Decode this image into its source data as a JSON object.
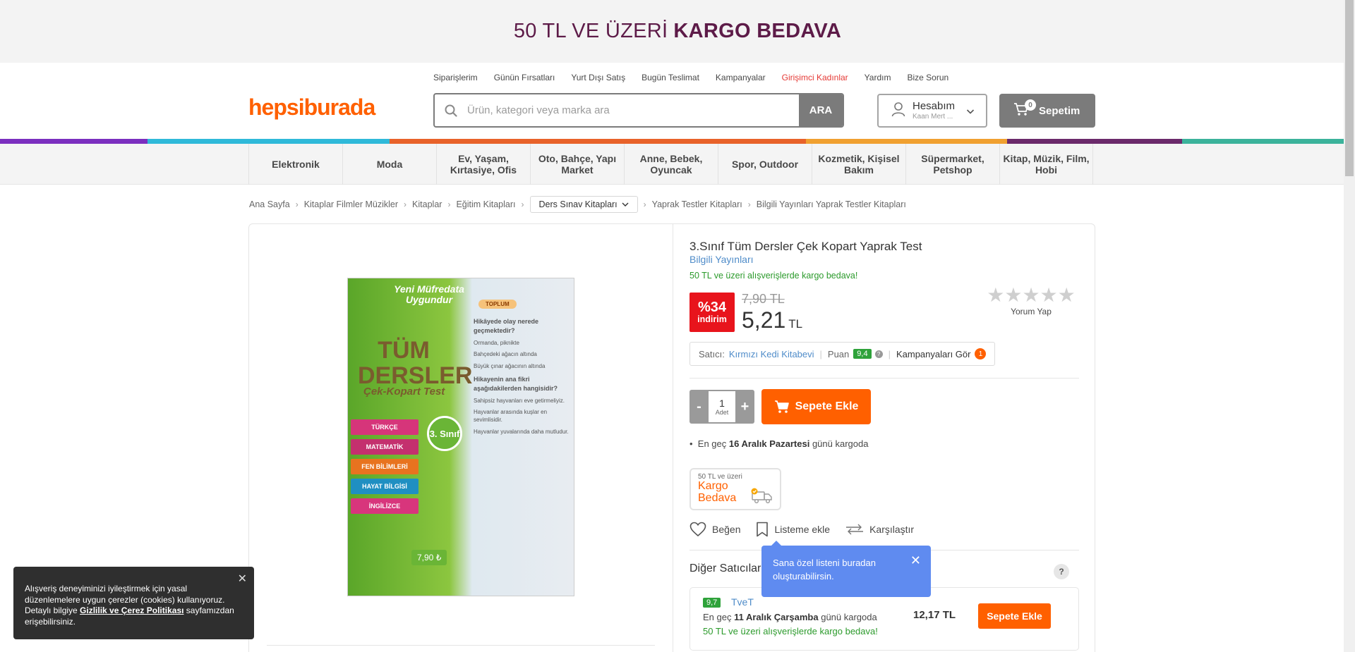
{
  "promo": {
    "prefix": "50 TL VE ÜZERİ",
    "strong": "KARGO BEDAVA"
  },
  "top_links": [
    "Siparişlerim",
    "Günün Fırsatları",
    "Yurt Dışı Satış",
    "Bugün Teslimat",
    "Kampanyalar",
    "Girişimci Kadınlar",
    "Yardım",
    "Bize Sorun"
  ],
  "logo": "hepsiburada",
  "search": {
    "placeholder": "Ürün, kategori veya marka ara",
    "button": "ARA"
  },
  "account": {
    "label": "Hesabım",
    "user": "Kaan Mert ..."
  },
  "cart": {
    "label": "Sepetim",
    "count": "0"
  },
  "stripe_colors": [
    "#7b2fbf",
    "#2fb9d9",
    "#e8622a",
    "#f0a030",
    "#6b2a6b",
    "#3bb39b"
  ],
  "categories": [
    {
      "label": "Elektronik"
    },
    {
      "label": "Moda"
    },
    {
      "label": "Ev, Yaşam, Kırtasiye, Ofis"
    },
    {
      "label": "Oto, Bahçe, Yapı Market"
    },
    {
      "label": "Anne, Bebek, Oyuncak"
    },
    {
      "label": "Spor, Outdoor"
    },
    {
      "label": "Kozmetik, Kişisel Bakım"
    },
    {
      "label": "Süpermarket, Petshop"
    },
    {
      "label": "Kitap, Müzik, Film, Hobi"
    }
  ],
  "breadcrumb": {
    "items": [
      "Ana Sayfa",
      "Kitaplar Filmler Müzikler",
      "Kitaplar",
      "Eğitim Kitapları"
    ],
    "dropdown": "Ders Sınav Kitapları",
    "tail": [
      "Yaprak Testler Kitapları",
      "Bilgili Yayınları Yaprak Testler Kitapları"
    ]
  },
  "book_cover": {
    "header": "Yeni Müfredata Uygundur",
    "title": "TÜM DERSLER",
    "subtitle": "Çek-Kopart Test",
    "tabs": [
      "TÜRKÇE",
      "MATEMATİK",
      "FEN BİLİMLERİ",
      "HAYAT BİLGİSİ",
      "İNGİLİZCE"
    ],
    "grade": "3. Sınıf",
    "price": "7,90 ₺",
    "badge": "TOPLUM",
    "lines": [
      "Hikâyede olay nerede geçmektedir?",
      "Ormanda, piknikte",
      "Bahçedeki ağacın altında",
      "Büyük çınar ağacının altında",
      "Hikayenin ana fikri aşağıdakilerden hangisidir?",
      "Sahipsiz hayvanları eve getirmeliyiz.",
      "Hayvanlar arasında kuşlar en sevimlisidir.",
      "Hayvanlar yuvalarında daha mutludur."
    ]
  },
  "product": {
    "title": "3.Sınıf Tüm Dersler Çek Kopart Yaprak Test",
    "brand": "Bilgili Yayınları",
    "shipping_note": "50 TL ve üzeri alışverişlerde kargo bedava!",
    "discount_pct": "%34",
    "discount_label": "indirim",
    "old_price": "7,90 TL",
    "price": "5,21",
    "currency": "TL",
    "rating_stars": 0,
    "review_label": "Yorum Yap",
    "seller_label": "Satıcı:",
    "seller_name": "Kırmızı Kedi Kitabevi",
    "score_label": "Puan",
    "score": "9,4",
    "campaigns_label": "Kampanyaları Gör",
    "campaigns_count": "1",
    "quantity": "1",
    "quantity_unit": "Adet",
    "add_to_cart": "Sepete Ekle",
    "delivery_prefix": "En geç",
    "delivery_date": "16 Aralık Pazartesi",
    "delivery_suffix": "günü kargoda",
    "kargo_small": "50 TL ve üzeri",
    "kargo_big1": "Kargo",
    "kargo_big2": "Bedava",
    "like": "Beğen",
    "list_add": "Listeme ekle",
    "compare": "Karşılaştır"
  },
  "other_sellers": {
    "title": "Diğer Satıcılar",
    "offers": [
      {
        "score": "9,7",
        "name": "TveT",
        "delivery_prefix": "En geç",
        "delivery_date": "11 Aralık Çarşamba",
        "delivery_suffix": "günü kargoda",
        "free_ship": "50 TL ve üzeri alışverişlerde kargo bedava!",
        "price": "12,17 TL",
        "button": "Sepete Ekle"
      }
    ]
  },
  "tooltip": {
    "text": "Sana özel listeni buradan oluşturabilirsin."
  },
  "cookie": {
    "text1": "Alışveriş deneyiminizi iyileştirmek için yasal düzenlemelere uygun çerezler (cookies) kullanıyoruz. Detaylı bilgiye",
    "link": "Gizlilik ve Çerez Politikası",
    "text2": "sayfamızdan erişebilirsiniz."
  }
}
